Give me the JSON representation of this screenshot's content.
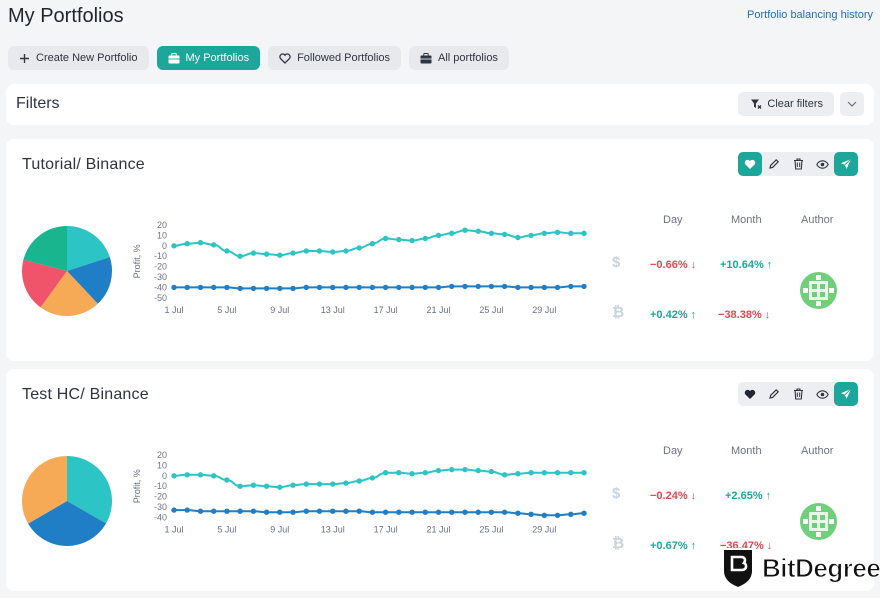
{
  "page": {
    "title": "My Portfolios",
    "history_link": "Portfolio balancing history"
  },
  "tabs": [
    {
      "label": "Create New Portfolio",
      "icon": "plus-icon",
      "active": false
    },
    {
      "label": "My Portfolios",
      "icon": "briefcase-icon",
      "active": true
    },
    {
      "label": "Followed Portfolios",
      "icon": "heart-icon",
      "active": false
    },
    {
      "label": "All portfolios",
      "icon": "briefcase-icon",
      "active": false
    }
  ],
  "filters": {
    "title": "Filters",
    "clear_label": "Clear filters"
  },
  "colors": {
    "accent": "#1ca79a",
    "negative": "#e0484e",
    "series_usd": "#2cc4c4",
    "series_btc": "#1f7ec6"
  },
  "stats_headers": {
    "day": "Day",
    "month": "Month",
    "author": "Author"
  },
  "portfolios": [
    {
      "title": "Tutorial/ Binance",
      "liked": true,
      "pie": [
        {
          "color": "#2cc4c4",
          "fraction": 0.2
        },
        {
          "color": "#1f7ec6",
          "fraction": 0.18
        },
        {
          "color": "#f6aa56",
          "fraction": 0.22
        },
        {
          "color": "#f0546a",
          "fraction": 0.19
        },
        {
          "color": "#19b58e",
          "fraction": 0.21
        }
      ],
      "usd": {
        "symbol": "$",
        "day": "−0.66% ↓",
        "month": "+10.64% ↑"
      },
      "btc": {
        "symbol": "₿",
        "day": "+0.42% ↑",
        "month": "−38.38% ↓"
      }
    },
    {
      "title": "Test HC/ Binance",
      "liked": false,
      "pie": [
        {
          "color": "#2cc4c4",
          "fraction": 0.333
        },
        {
          "color": "#1f7ec6",
          "fraction": 0.333
        },
        {
          "color": "#f6aa56",
          "fraction": 0.334
        }
      ],
      "usd": {
        "symbol": "$",
        "day": "−0.24% ↓",
        "month": "+2.65% ↑"
      },
      "btc": {
        "symbol": "₿",
        "day": "+0.67% ↑",
        "month": "−36.47% ↓"
      }
    }
  ],
  "chart_data": [
    {
      "type": "line",
      "ylabel": "Profit, %",
      "ylim": [
        -50,
        20
      ],
      "yticks": [
        20,
        10,
        0,
        -10,
        -20,
        -30,
        -40,
        -50
      ],
      "x_ticks": [
        "1 Jul",
        "5 Jul",
        "9 Jul",
        "13 Jul",
        "17 Jul",
        "21 Jul",
        "25 Jul",
        "29 Jul"
      ],
      "series": [
        {
          "color": "#2cc4c4",
          "values": [
            0,
            2,
            3,
            1,
            -5,
            -10,
            -7,
            -8,
            -9,
            -7,
            -5,
            -5,
            -6,
            -5,
            -2,
            2,
            7,
            6,
            5,
            7,
            10,
            12,
            15,
            14,
            12,
            11,
            8,
            10,
            12,
            13,
            12,
            12
          ]
        },
        {
          "color": "#1f7ec6",
          "values": [
            -40,
            -40,
            -40,
            -40,
            -40,
            -41,
            -41,
            -41,
            -41,
            -41,
            -40,
            -40,
            -40,
            -40,
            -40,
            -40,
            -40,
            -40,
            -40,
            -40,
            -40,
            -39,
            -39,
            -39,
            -39,
            -39,
            -40,
            -40,
            -40,
            -40,
            -39,
            -39
          ]
        }
      ]
    },
    {
      "type": "line",
      "ylabel": "Profit, %",
      "ylim": [
        -40,
        20
      ],
      "yticks": [
        20,
        10,
        0,
        -10,
        -20,
        -30,
        -40
      ],
      "x_ticks": [
        "1 Jul",
        "5 Jul",
        "9 Jul",
        "13 Jul",
        "17 Jul",
        "21 Jul",
        "25 Jul",
        "29 Jul"
      ],
      "series": [
        {
          "color": "#2cc4c4",
          "values": [
            0,
            1,
            1,
            0,
            -4,
            -10,
            -9,
            -10,
            -11,
            -9,
            -8,
            -8,
            -8,
            -7,
            -5,
            -2,
            3,
            3,
            2,
            3,
            5,
            6,
            6,
            5,
            4,
            1,
            2,
            3,
            3,
            3,
            3,
            3
          ]
        },
        {
          "color": "#1f7ec6",
          "values": [
            -33,
            -33,
            -34,
            -34,
            -34,
            -34,
            -34,
            -35,
            -35,
            -35,
            -34,
            -34,
            -34,
            -34,
            -34,
            -35,
            -35,
            -35,
            -35,
            -35,
            -35,
            -35,
            -35,
            -35,
            -35,
            -35,
            -36,
            -37,
            -38,
            -38,
            -37,
            -36
          ]
        }
      ]
    }
  ],
  "watermark": {
    "text": "BitDegree"
  }
}
